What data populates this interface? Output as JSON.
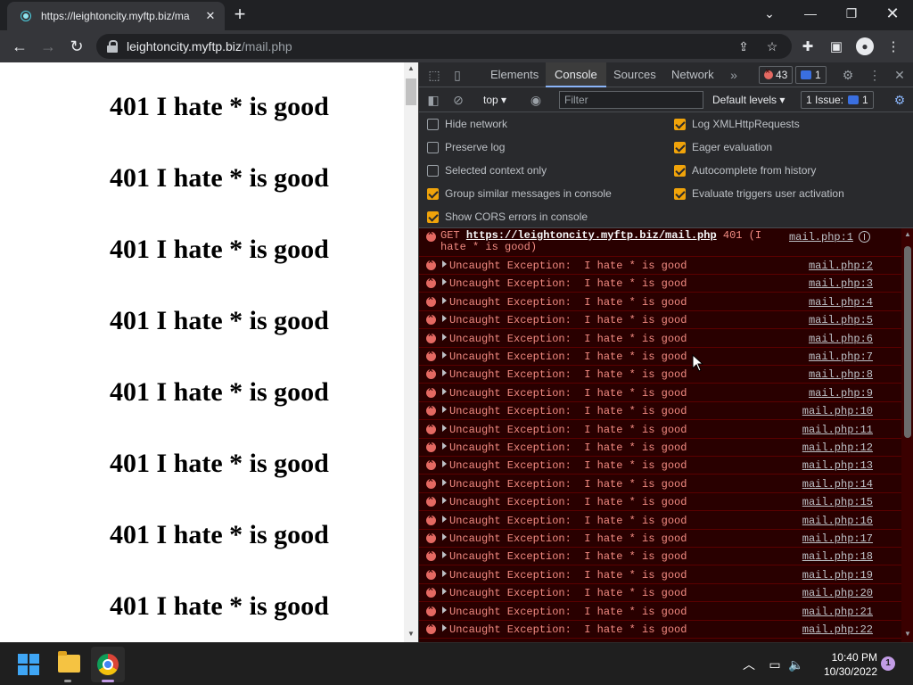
{
  "browser": {
    "tab_title": "https://leightoncity.myftp.biz/ma",
    "tab_close": "✕",
    "new_tab": "+",
    "url_host": "leightoncity.myftp.biz",
    "url_path": "/mail.php"
  },
  "page": {
    "heading": "401 I hate * is good"
  },
  "devtools": {
    "tabs": [
      "Elements",
      "Console",
      "Sources",
      "Network"
    ],
    "active_tab": "Console",
    "error_count": "43",
    "message_count": "1",
    "context": "top",
    "filter_placeholder": "Filter",
    "levels": "Default levels",
    "issues_label": "1 Issue:",
    "issues_count": "1",
    "settings_left": [
      {
        "label": "Hide network",
        "checked": false
      },
      {
        "label": "Preserve log",
        "checked": false
      },
      {
        "label": "Selected context only",
        "checked": false
      },
      {
        "label": "Group similar messages in console",
        "checked": true
      },
      {
        "label": "Show CORS errors in console",
        "checked": true
      }
    ],
    "settings_right": [
      {
        "label": "Log XMLHttpRequests",
        "checked": true
      },
      {
        "label": "Eager evaluation",
        "checked": true
      },
      {
        "label": "Autocomplete from history",
        "checked": true
      },
      {
        "label": "Evaluate triggers user activation",
        "checked": true
      }
    ],
    "first_message": {
      "method": "GET",
      "url": "https://leightoncity.myftp.biz/mail.php",
      "status": "401 (I hate * is good)",
      "source": "mail.php:1"
    },
    "exception_message": "Uncaught Exception:  I hate * is good",
    "exception_sources": [
      "mail.php:2",
      "mail.php:3",
      "mail.php:4",
      "mail.php:5",
      "mail.php:6",
      "mail.php:7",
      "mail.php:8",
      "mail.php:9",
      "mail.php:10",
      "mail.php:11",
      "mail.php:12",
      "mail.php:13",
      "mail.php:14",
      "mail.php:15",
      "mail.php:16",
      "mail.php:17",
      "mail.php:18",
      "mail.php:19",
      "mail.php:20",
      "mail.php:21",
      "mail.php:22"
    ]
  },
  "taskbar": {
    "time": "10:40 PM",
    "date": "10/30/2022",
    "notification_count": "1"
  }
}
